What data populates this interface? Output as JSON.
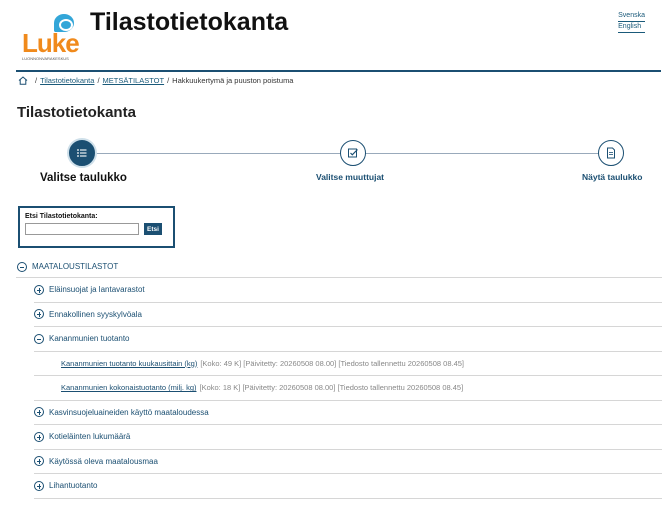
{
  "header": {
    "site_title": "Tilastotietokanta",
    "logo_text": "Luke",
    "logo_subtext": "LUONNONVARAKESKUS",
    "languages": [
      "Svenska",
      "English"
    ]
  },
  "breadcrumb": {
    "items": [
      "Tilastotietokanta",
      "METSÄTILASTOT"
    ],
    "current": "Hakkuukertymä ja puuston poistuma",
    "separator": "/"
  },
  "page": {
    "title": "Tilastotietokanta"
  },
  "steps": [
    {
      "label": "Valitse taulukko",
      "active": true,
      "icon": "list-icon"
    },
    {
      "label": "Valitse muuttujat",
      "active": false,
      "icon": "checkbox-icon"
    },
    {
      "label": "Näytä taulukko",
      "active": false,
      "icon": "document-icon"
    }
  ],
  "search": {
    "label": "Etsi Tilastotietokanta:",
    "value": "",
    "button": "Etsi"
  },
  "tree": {
    "root": {
      "label": "MAATALOUSTILASTOT",
      "expanded": true
    },
    "children": [
      {
        "label": "Eläinsuojat ja lantavarastot",
        "expanded": false
      },
      {
        "label": "Ennakollinen syyskylvöala",
        "expanded": false
      },
      {
        "label": "Kananmunien tuotanto",
        "expanded": true
      },
      {
        "label": "Kasvinsuojeluaineiden käyttö maataloudessa",
        "expanded": false
      },
      {
        "label": "Kotieläinten lukumäärä",
        "expanded": false
      },
      {
        "label": "Käytössä oleva maatalousmaa",
        "expanded": false
      },
      {
        "label": "Lihantuotanto",
        "expanded": false
      }
    ],
    "tables": [
      {
        "title": "Kananmunien tuotanto kuukausittain (kg)",
        "meta": "[Koko: 49 K] [Päivitetty: 20260508 08.00] [Tiedosto tallennettu 20260508 08.45]"
      },
      {
        "title": "Kananmunien kokonaistuotanto (milj. kg)",
        "meta": "[Koko: 18 K] [Päivitetty: 20260508 08.00] [Tiedosto tallennettu 20260508 08.45]"
      }
    ]
  },
  "colors": {
    "accent": "#1b4f72",
    "logo_orange": "#f08a1c",
    "logo_blue": "#33a6d8"
  }
}
